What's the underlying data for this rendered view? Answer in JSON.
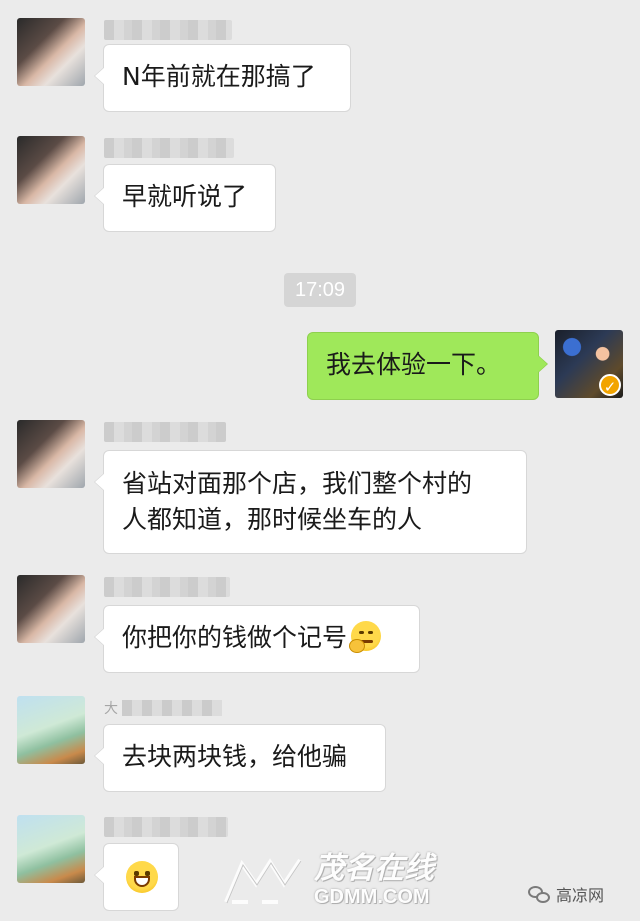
{
  "colors": {
    "background": "#ebebeb",
    "incoming_bubble": "#ffffff",
    "outgoing_bubble": "#9fe85a",
    "timestamp_pill": "#d5d5d5"
  },
  "timestamp": "17:09",
  "messages": [
    {
      "side": "left",
      "avatar": "blurred-avatar-a",
      "text": "N年前就在那搞了"
    },
    {
      "side": "left",
      "avatar": "blurred-avatar-a",
      "text": "早就听说了"
    },
    {
      "side": "right",
      "avatar": "user-avatar",
      "text": "我去体验一下。"
    },
    {
      "side": "left",
      "avatar": "blurred-avatar-a",
      "line1": "省站对面那个店，我们整个村的",
      "line2": "人都知道，那时候坐车的人"
    },
    {
      "side": "left",
      "avatar": "blurred-avatar-a",
      "text": "你把你的钱做个记号",
      "emoji": "thinking-face-emoji"
    },
    {
      "side": "left",
      "avatar": "blurred-avatar-b",
      "nick_initial": "大",
      "text": "去块两块钱，给他骗"
    },
    {
      "side": "left",
      "avatar": "blurred-avatar-b",
      "emoji": "grinning-face-emoji"
    }
  ],
  "watermarks": {
    "site_name": "茂名在线",
    "site_domain": "GDMM.COM",
    "wechat_account": "高凉网"
  }
}
